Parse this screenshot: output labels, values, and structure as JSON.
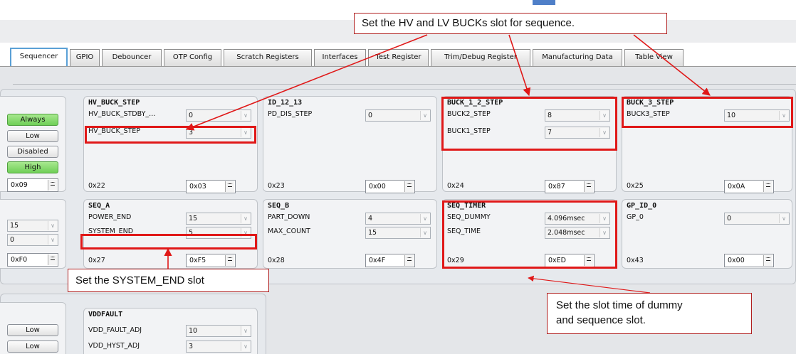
{
  "tabs": [
    "Sequencer",
    "GPIO",
    "Debouncer",
    "OTP Config",
    "Scratch Registers",
    "Interfaces",
    "Test Register",
    "Trim/Debug Register",
    "Manufacturing Data",
    "Table View"
  ],
  "active_tab": "Sequencer",
  "left_column": {
    "buttons": [
      "Always",
      "Low",
      "Disabled",
      "High"
    ],
    "hex_top": "0x09",
    "dd1": "15",
    "dd2": "0",
    "hex_mid": "0xF0",
    "low_buttons": [
      "Low",
      "Low"
    ]
  },
  "panels": {
    "hv_buck_step": {
      "title": "HV_BUCK_STEP",
      "row1_label": "HV_BUCK_STDBY_...",
      "row1_value": "0",
      "row2_label": "HV_BUCK_STEP",
      "row2_value": "3",
      "addr": "0x22",
      "hex": "0x03"
    },
    "id_12_13": {
      "title": "ID_12_13",
      "row1_label": "PD_DIS_STEP",
      "row1_value": "0",
      "addr": "0x23",
      "hex": "0x00"
    },
    "buck_1_2_step": {
      "title": "BUCK_1_2_STEP",
      "row1_label": "BUCK2_STEP",
      "row1_value": "8",
      "row2_label": "BUCK1_STEP",
      "row2_value": "7",
      "addr": "0x24",
      "hex": "0x87"
    },
    "buck_3_step": {
      "title": "BUCK_3_STEP",
      "row1_label": "BUCK3_STEP",
      "row1_value": "10",
      "addr": "0x25",
      "hex": "0x0A"
    },
    "seq_a": {
      "title": "SEQ_A",
      "row1_label": "POWER_END",
      "row1_value": "15",
      "row2_label": "SYSTEM_END",
      "row2_value": "5",
      "addr": "0x27",
      "hex": "0xF5"
    },
    "seq_b": {
      "title": "SEQ_B",
      "row1_label": "PART_DOWN",
      "row1_value": "4",
      "row2_label": "MAX_COUNT",
      "row2_value": "15",
      "addr": "0x28",
      "hex": "0x4F"
    },
    "seq_timer": {
      "title": "SEQ_TIMER",
      "row1_label": "SEQ_DUMMY",
      "row1_value": "4.096msec",
      "row2_label": "SEQ_TIME",
      "row2_value": "2.048msec",
      "addr": "0x29",
      "hex": "0xED"
    },
    "gp_id_0": {
      "title": "GP_ID_0",
      "row1_label": "GP_0",
      "row1_value": "0",
      "addr": "0x43",
      "hex": "0x00"
    },
    "vddfault": {
      "title": "VDDFAULT",
      "row1_label": "VDD_FAULT_ADJ",
      "row1_value": "10",
      "row2_label": "VDD_HYST_ADJ",
      "row2_value": "3"
    }
  },
  "annotations": {
    "top": "Set the HV and LV BUCKs slot for sequence.",
    "system_end": "Set the SYSTEM_END slot",
    "slot_time_line1": "Set the slot time of dummy",
    "slot_time_line2": "and sequence slot."
  },
  "colors": {
    "highlight": "#e01818",
    "green_button": "#6fcf57",
    "active_tab_border": "#5aa0d6"
  }
}
